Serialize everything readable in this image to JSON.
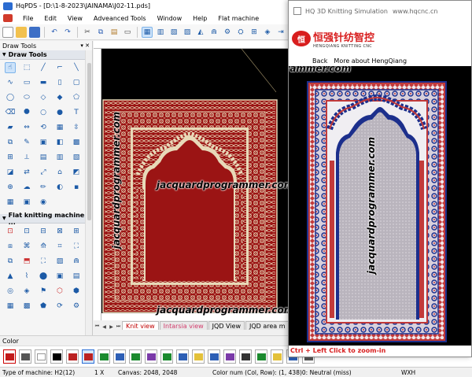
{
  "window": {
    "title": "HqPDS - [D:\\1-8-2023\\JAINAMA\\J02-11.pds]"
  },
  "menu": [
    "File",
    "Edit",
    "View",
    "Adveanced Tools",
    "Window",
    "Help",
    "Flat machine"
  ],
  "left_panel": {
    "title": "Draw Tools",
    "section1": "Draw Tools",
    "section2": "Flat knitting machine ..."
  },
  "tabs": [
    "Knit view",
    "Intarsia view",
    "JQD View",
    "JQD area m"
  ],
  "watermark": "jacquardprogrammer.com",
  "color_bar": {
    "label": "Color"
  },
  "status": {
    "machine": "Type of machine: H2(12)",
    "zoom": "1 X",
    "canvas": "Canvas: 2048, 2048",
    "colnum": "Color num (Col, Row): (1, 438)0: Neutral (miss)",
    "wxh": "WXH"
  },
  "sim": {
    "title": "HQ 3D Knitting Simulation",
    "url": "www.hqcnc.cn",
    "brand_cn": "恒强针纺智控",
    "brand_en": "HENGQIANG KNITTING CNC",
    "nav": [
      "Back",
      "More about HengQiang"
    ],
    "hint": "Ctrl + Left Click to zoom-in"
  },
  "colors": {
    "carpet_red": "#9b1414",
    "border_cream": "#e8d9b8",
    "sim_blue": "#1c2f8c",
    "sim_red": "#c23a3a",
    "hint_red": "#d81e1e"
  }
}
